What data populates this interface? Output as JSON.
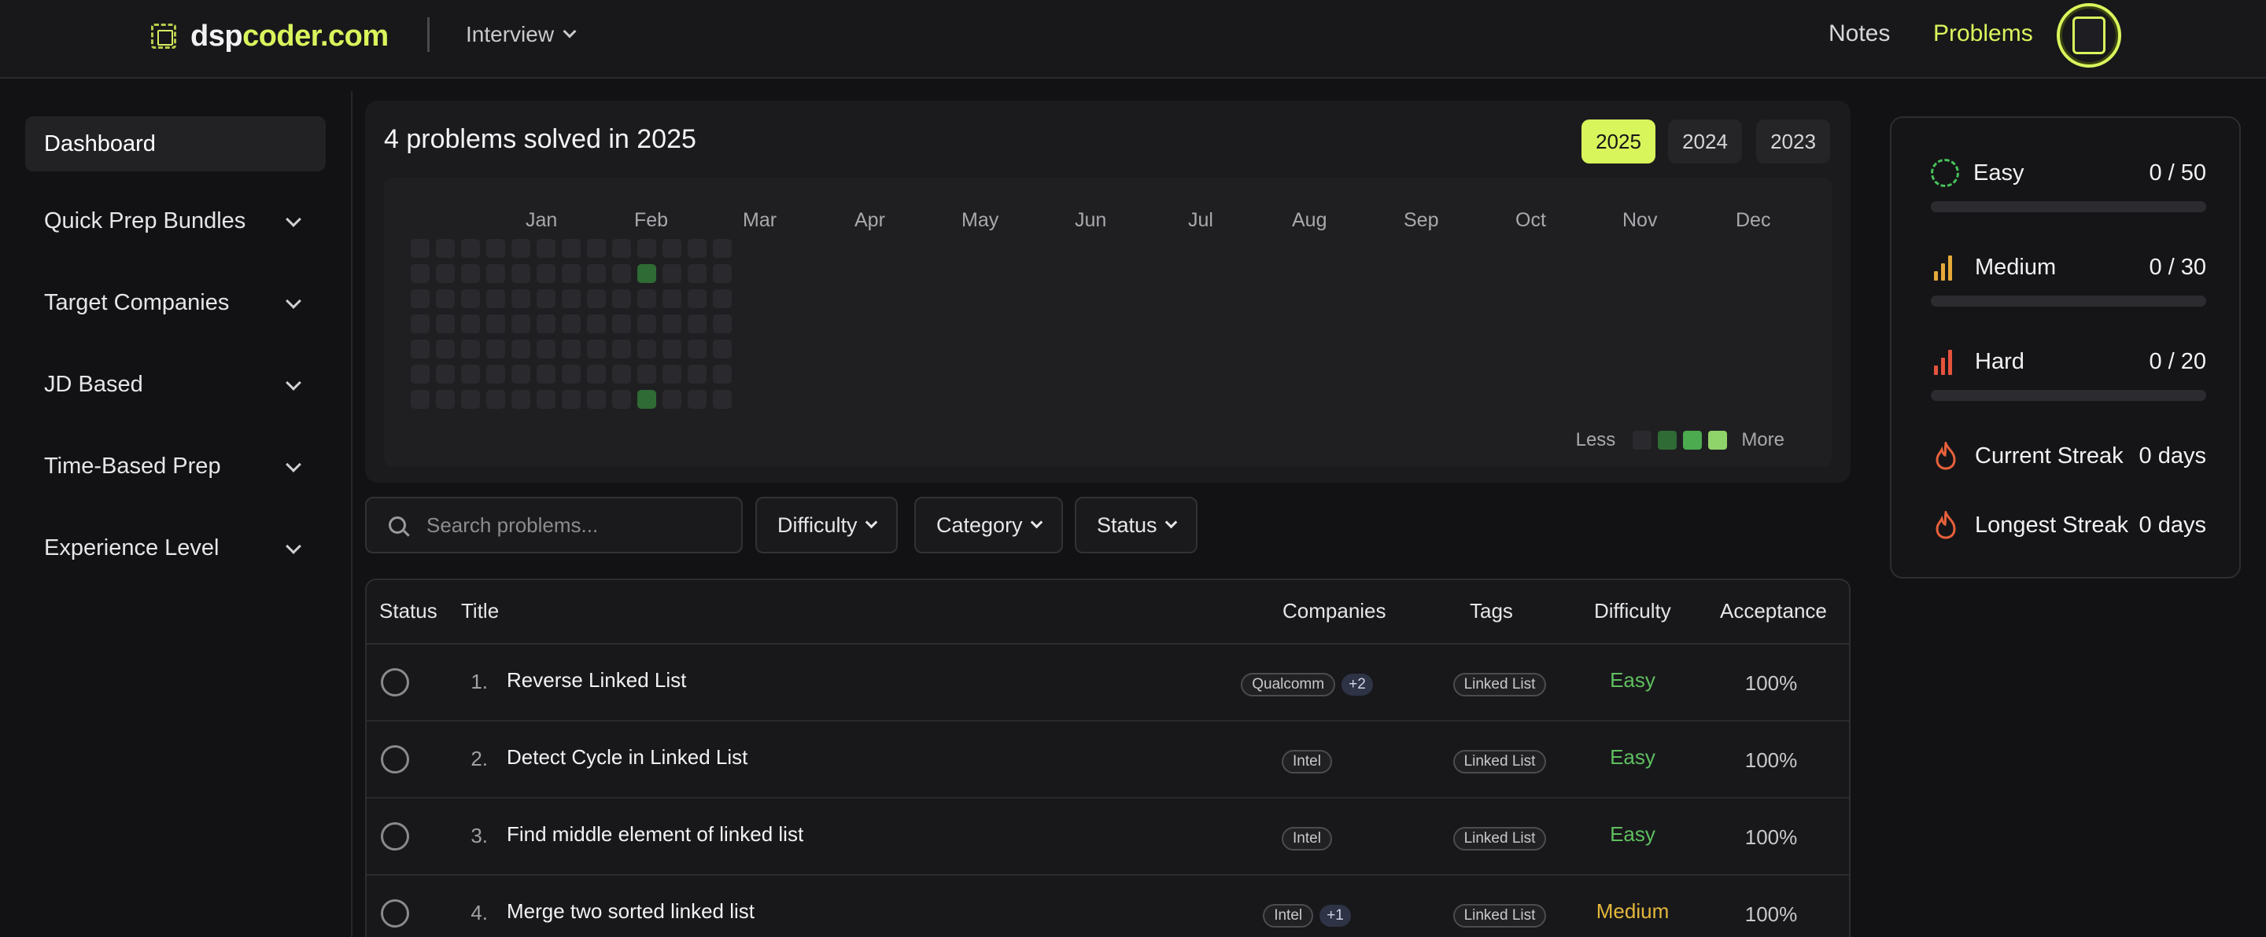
{
  "header": {
    "brand_prefix": "dsp",
    "brand_suffix": "coder.com",
    "menu_label": "Interview",
    "links": [
      {
        "label": "Notes"
      },
      {
        "label": "Problems"
      }
    ]
  },
  "sidebar": {
    "items": [
      {
        "label": "Dashboard"
      },
      {
        "label": "Quick Prep Bundles"
      },
      {
        "label": "Target Companies"
      },
      {
        "label": "JD Based"
      },
      {
        "label": "Time-Based Prep"
      },
      {
        "label": "Experience Level"
      }
    ]
  },
  "activity": {
    "title": "4 problems solved in 2025",
    "years": [
      "2025",
      "2024",
      "2023"
    ],
    "selected_year": "2025",
    "months": [
      "Jan",
      "Feb",
      "Mar",
      "Apr",
      "May",
      "Jun",
      "Jul",
      "Aug",
      "Sep",
      "Oct",
      "Nov",
      "Dec"
    ],
    "legend_less": "Less",
    "legend_more": "More",
    "legend_colors": [
      "#2a2a2e",
      "#2f6b35",
      "#4caa4f",
      "#8fd46a"
    ],
    "solved_days": [
      {
        "week": 9,
        "day": 1
      },
      {
        "week": 9,
        "day": 6
      }
    ]
  },
  "filters": {
    "search_placeholder": "Search problems...",
    "difficulty_label": "Difficulty",
    "category_label": "Category",
    "status_label": "Status"
  },
  "table": {
    "headers": {
      "status": "Status",
      "title": "Title",
      "companies": "Companies",
      "tags": "Tags",
      "difficulty": "Difficulty",
      "acceptance": "Acceptance"
    },
    "rows": [
      {
        "num": "1.",
        "title": "Reverse Linked List",
        "company": "Qualcomm",
        "more": "+2",
        "tag": "Linked List",
        "difficulty": "Easy",
        "acceptance": "100%"
      },
      {
        "num": "2.",
        "title": "Detect Cycle in Linked List",
        "company": "Intel",
        "more": "",
        "tag": "Linked List",
        "difficulty": "Easy",
        "acceptance": "100%"
      },
      {
        "num": "3.",
        "title": "Find middle element of linked list",
        "company": "Intel",
        "more": "",
        "tag": "Linked List",
        "difficulty": "Easy",
        "acceptance": "100%"
      },
      {
        "num": "4.",
        "title": "Merge two sorted linked list",
        "company": "Intel",
        "more": "+1",
        "tag": "Linked List",
        "difficulty": "Medium",
        "acceptance": "100%"
      }
    ]
  },
  "stats": {
    "easy": {
      "label": "Easy",
      "value": "0 / 50",
      "progress": 0,
      "color": "#46c25c"
    },
    "medium": {
      "label": "Medium",
      "value": "0 / 30",
      "progress": 0,
      "color": "#e5a93a"
    },
    "hard": {
      "label": "Hard",
      "value": "0 / 20",
      "progress": 0,
      "color": "#e5533d"
    },
    "current_streak": {
      "label": "Current Streak",
      "value": "0 days"
    },
    "longest_streak": {
      "label": "Longest Streak",
      "value": "0 days"
    }
  },
  "colors": {
    "accent": "#d9f55c",
    "easy": "#5fbf5f",
    "medium": "#e5b73b",
    "hard": "#e5533d"
  }
}
